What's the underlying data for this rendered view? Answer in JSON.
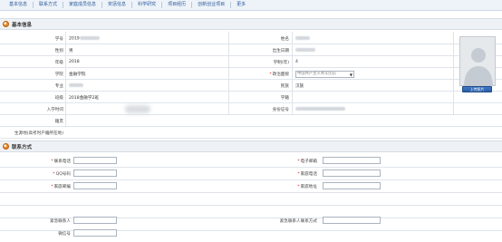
{
  "tabs": [
    "基本信息",
    "联系方式",
    "家庭成员信息",
    "奖惩信息",
    "科学研究",
    "项目经历",
    "创新创业项目",
    "更多"
  ],
  "sections": {
    "basic": "基本信息",
    "contact": "联系方式"
  },
  "basic": {
    "student_id_label": "学号",
    "student_id_value": "2019",
    "name_label": "姓名",
    "gender_label": "性别",
    "gender_value": "男",
    "birth_label": "出生日期",
    "grade_label": "年级",
    "grade_value": "2018",
    "length_label": "学制(年)",
    "length_value": "4",
    "dept_label": "学院",
    "dept_value": "金融学院",
    "political_label": "政治面貌",
    "political_value": "中国共产主义青年团员",
    "major_label": "专业",
    "ethnic_label": "民族",
    "ethnic_value": "汉族",
    "class_label": "班级",
    "class_value": "2018金融学2班",
    "campus_label": "学籍",
    "enroll_label": "入学时间",
    "id_label": "身份证号",
    "remark_label": "籍贯",
    "residence_label": "生源地(高考时户籍所在地)",
    "upload_label": "上传照片"
  },
  "contact": {
    "phone_label": "联系电话",
    "email_label": "电子邮箱",
    "qq_label": "QQ号码",
    "home_phone_label": "家庭电话",
    "zip_label": "家庭邮编",
    "address_label": "家庭地址",
    "emergency_label": "紧急联系人",
    "emergency_phone_label": "紧急联系人联系方式",
    "wechat_label": "微信号"
  }
}
